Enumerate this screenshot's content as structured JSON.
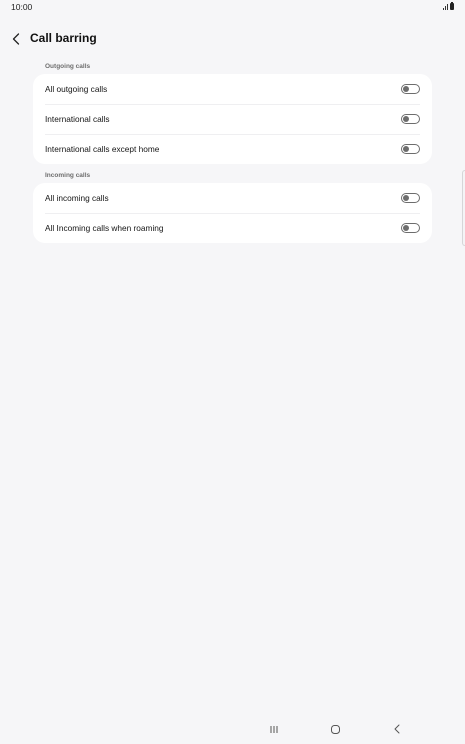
{
  "status_bar": {
    "time": "10:00",
    "icons": [
      "signal-icon",
      "battery-icon"
    ]
  },
  "header": {
    "title": "Call barring",
    "back_icon": "chevron-left-icon"
  },
  "sections": [
    {
      "label": "Outgoing calls",
      "items": [
        {
          "label": "All outgoing calls",
          "enabled": false
        },
        {
          "label": "International calls",
          "enabled": false
        },
        {
          "label": "International calls except home",
          "enabled": false
        }
      ]
    },
    {
      "label": "Incoming calls",
      "items": [
        {
          "label": "All incoming calls",
          "enabled": false
        },
        {
          "label": "All Incoming calls when roaming",
          "enabled": false
        }
      ]
    }
  ],
  "nav_bar": {
    "icons": [
      "recent-apps-icon",
      "home-icon",
      "back-icon"
    ]
  },
  "colors": {
    "background": "#f6f6f8",
    "card": "#ffffff",
    "toggle_off": "#6d6d6d"
  }
}
